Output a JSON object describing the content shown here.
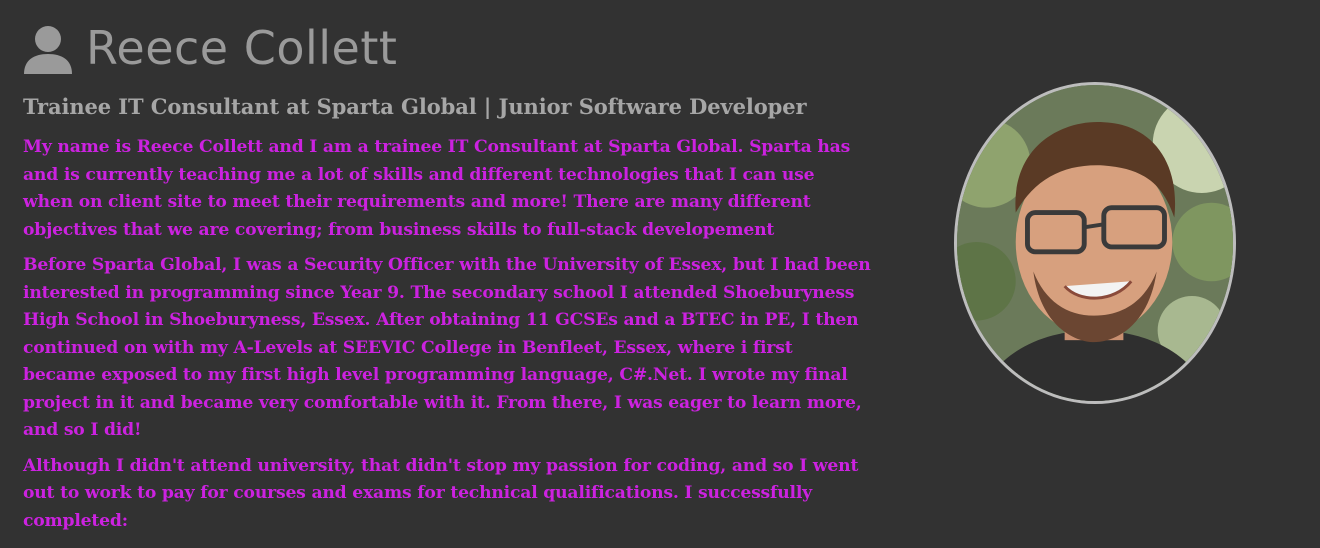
{
  "profile": {
    "name": "Reece Collett",
    "icon": "user-icon",
    "subtitle": "Trainee IT Consultant at Sparta Global | Junior Software Developer",
    "text_color": "#cc22e0",
    "background_color": "#323232"
  },
  "bio": {
    "paragraphs": [
      "My name is Reece Collett and I am a trainee IT Consultant at Sparta Global. Sparta has\nand is currently teaching me a lot of skills and different technologies that I can use\nwhen on client site to meet their requirements and more! There are many different\nobjectives that we are covering; from business skills to full-stack developement",
      "Before Sparta Global, I was a Security Officer with the University of Essex, but I had been\ninterested in programming since Year 9. The secondary school I attended Shoeburyness\nHigh School in Shoeburyness, Essex. After obtaining 11 GCSEs and a BTEC in PE, I then\ncontinued on with my A-Levels at SEEVIC College in Benfleet, Essex, where i first\nbecame exposed to my first high level programming language, C#.Net. I wrote my final\nproject in it and became very comfortable with it. From there, I was eager to learn more,\nand so I did!",
      "Although I didn't attend university, that didn't stop my passion for coding, and so I went\nout to work to pay for courses and exams for technical qualifications. I successfully\ncompleted:"
    ]
  }
}
